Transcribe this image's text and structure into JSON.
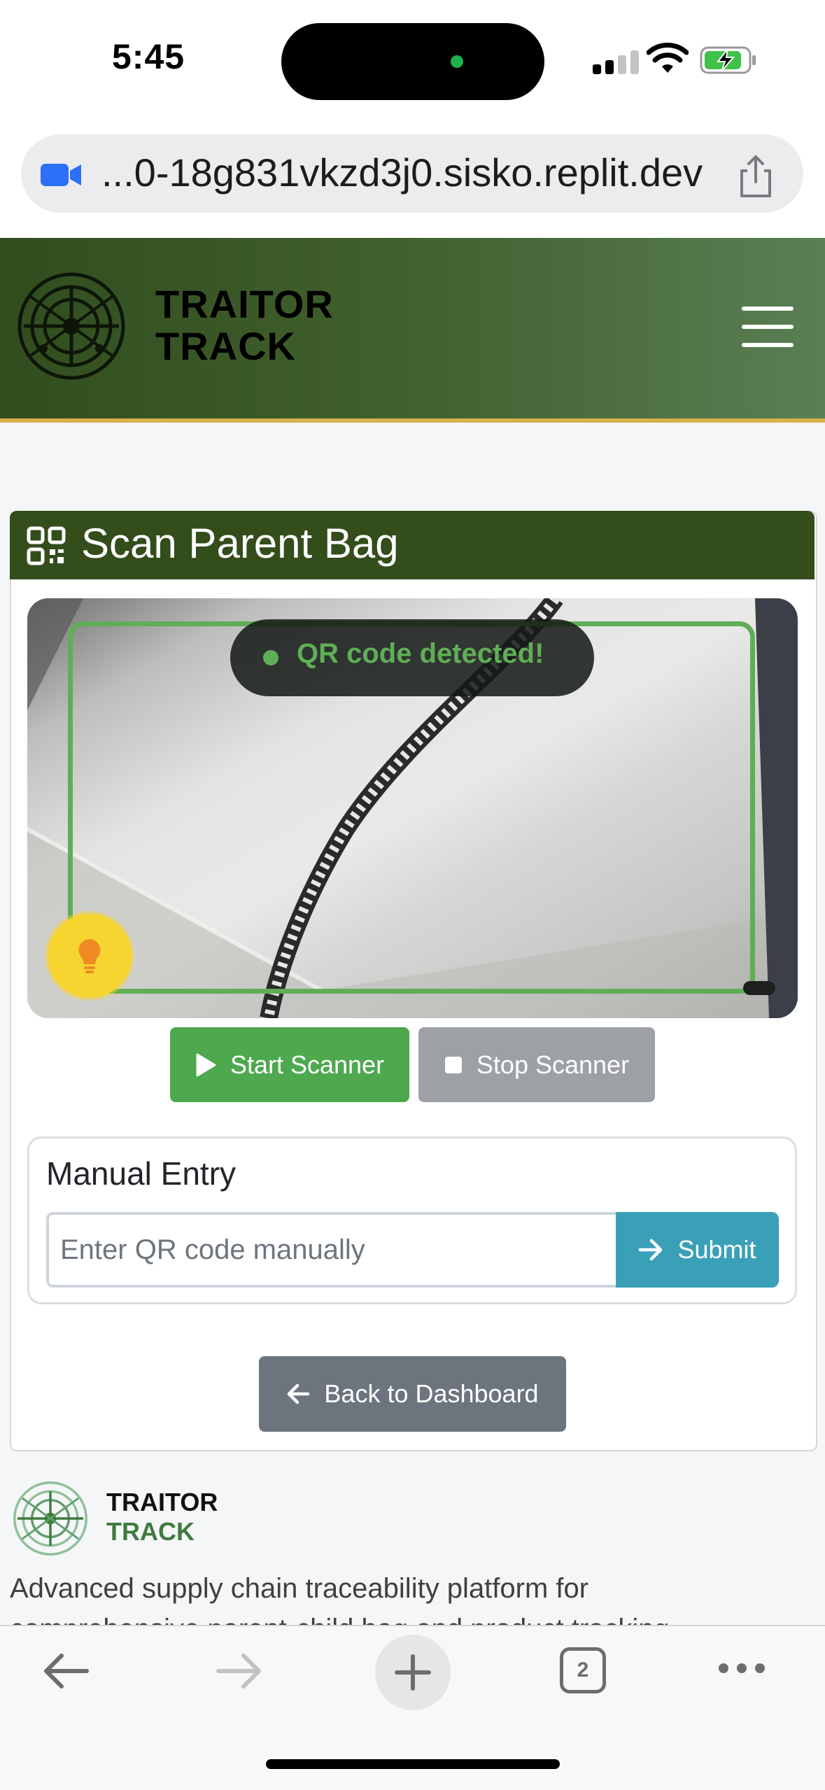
{
  "status_bar": {
    "time": "5:45"
  },
  "browser": {
    "url": "...0-18g831vkzd3j0.sisko.replit.dev",
    "tab_count": "2"
  },
  "header": {
    "brand_line1": "TRAITOR",
    "brand_line2": "TRACK"
  },
  "scan_card": {
    "title": "Scan Parent Bag",
    "detect_message": "QR code detected!",
    "start_label": "Start Scanner",
    "stop_label": "Stop Scanner"
  },
  "manual_entry": {
    "title": "Manual Entry",
    "placeholder": "Enter QR code manually",
    "value": "",
    "submit_label": "Submit"
  },
  "back_label": "Back to Dashboard",
  "footer": {
    "brand_line1": "TRAITOR",
    "brand_line2": "TRACK",
    "description_line1": "Advanced supply chain traceability platform for",
    "description_line2": "comprehensive parent-child bag and product tracking"
  },
  "colors": {
    "header_gradient_start": "#314d1e",
    "header_gradient_end": "#5a7f55",
    "header_accent": "#d8b04c",
    "card_header": "#334d1b",
    "primary_green": "#4da84e",
    "secondary_gray": "#9da1a6",
    "info_teal": "#3aa0b8",
    "dark_gray": "#6c757d",
    "torch_yellow": "#f6d530"
  }
}
